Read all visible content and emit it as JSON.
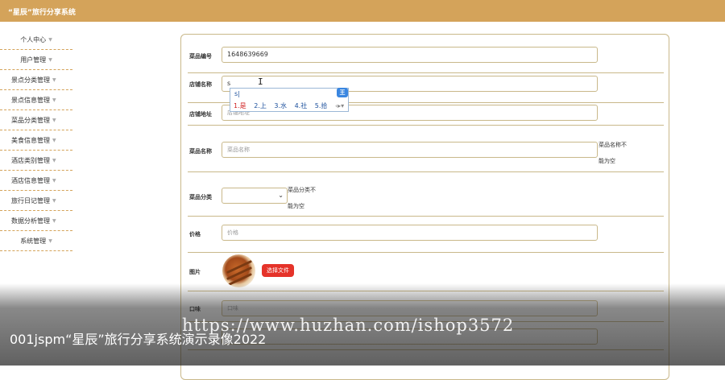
{
  "app": {
    "title": "“星辰”旅行分享系统"
  },
  "sidebar": {
    "items": [
      {
        "label": "个人中心"
      },
      {
        "label": "用户管理"
      },
      {
        "label": "景点分类管理"
      },
      {
        "label": "景点信息管理"
      },
      {
        "label": "菜品分类管理"
      },
      {
        "label": "美食信息管理"
      },
      {
        "label": "酒店类别管理"
      },
      {
        "label": "酒店信息管理"
      },
      {
        "label": "旅行日记管理"
      },
      {
        "label": "数据分析管理"
      },
      {
        "label": "系统管理"
      }
    ]
  },
  "form": {
    "dish_no": {
      "label": "菜品编号",
      "value": "1648639669"
    },
    "shop_name": {
      "label": "店铺名称",
      "value": "s"
    },
    "shop_address": {
      "label": "店铺地址",
      "placeholder": "店铺地址"
    },
    "dish_name": {
      "label": "菜品名称",
      "placeholder": "菜品名称",
      "note": "菜品名称不能为空"
    },
    "dish_category": {
      "label": "菜品分类",
      "note": "菜品分类不能为空"
    },
    "price": {
      "label": "价格",
      "placeholder": "价格"
    },
    "image": {
      "label": "图片",
      "button": "选择文件"
    },
    "taste": {
      "label": "口味",
      "placeholder": "口味"
    }
  },
  "ime": {
    "composition": "s|",
    "candidates": [
      "1.是",
      "2.上",
      "3.水",
      "4.社",
      "5.拾"
    ],
    "logo": "王"
  },
  "overlay": {
    "caption": "001jspm“星辰”旅行分享系统演示录像2022",
    "watermark": "https://www.huzhan.com/ishop3572"
  }
}
